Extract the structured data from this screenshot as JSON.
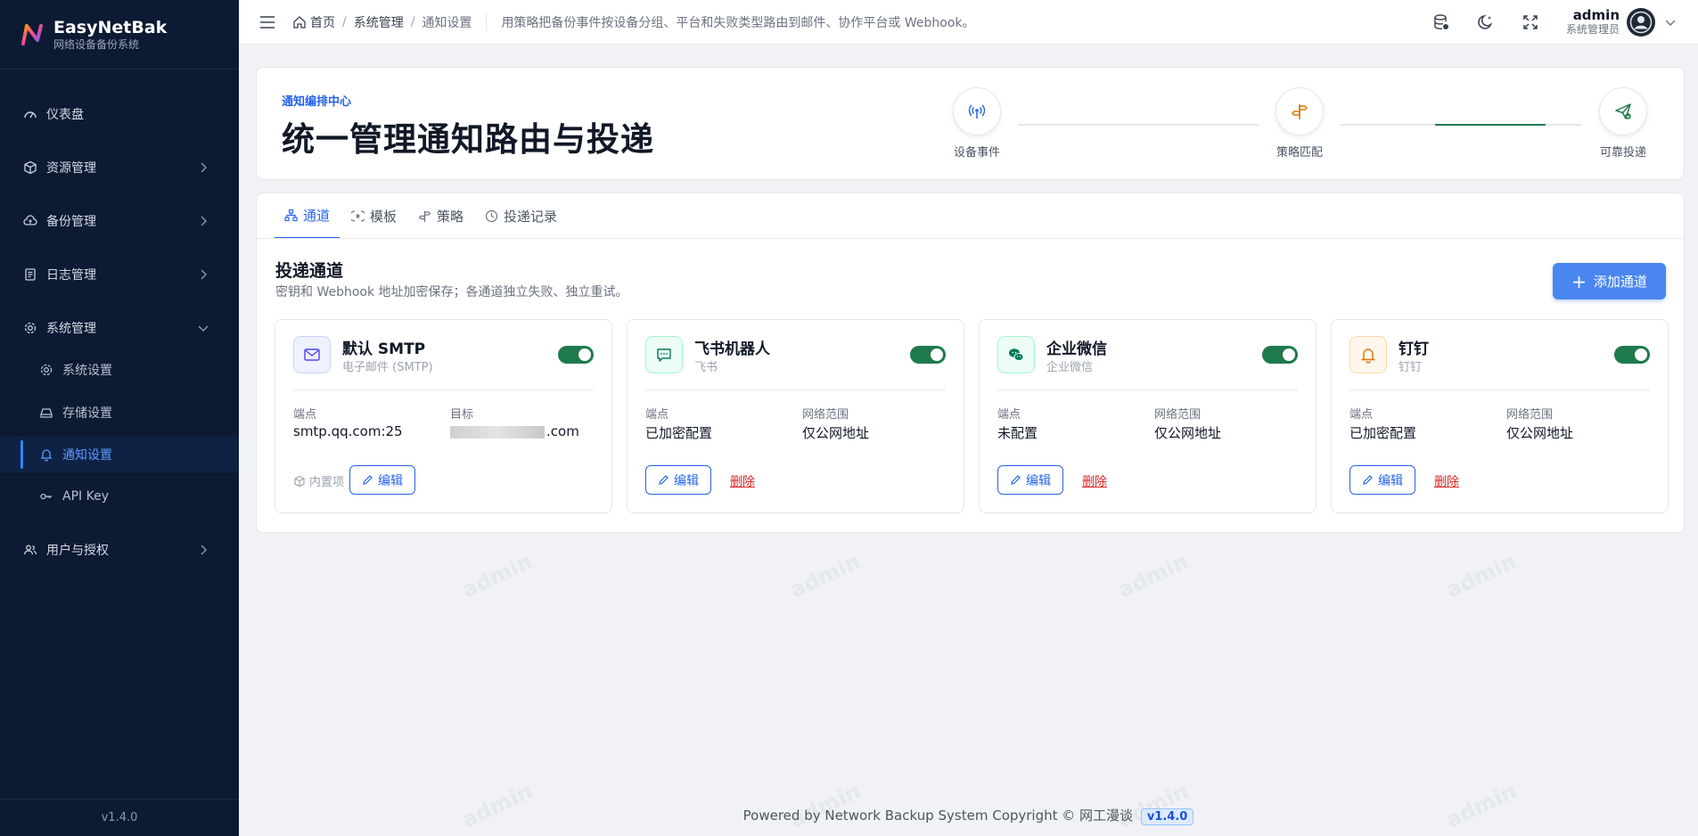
{
  "brand": {
    "name": "EasyNetBak",
    "subtitle": "网络设备备份系统"
  },
  "sidebar": {
    "items": [
      {
        "label": "仪表盘",
        "icon": "dashboard-icon"
      },
      {
        "label": "资源管理",
        "icon": "cube-icon"
      },
      {
        "label": "备份管理",
        "icon": "cloud-upload-icon"
      },
      {
        "label": "日志管理",
        "icon": "document-icon"
      },
      {
        "label": "系统管理",
        "icon": "gear-icon"
      },
      {
        "label": "用户与授权",
        "icon": "users-icon"
      }
    ],
    "sub_items": [
      {
        "label": "系统设置",
        "icon": "gear-icon"
      },
      {
        "label": "存储设置",
        "icon": "drive-icon"
      },
      {
        "label": "通知设置",
        "icon": "bell-icon"
      },
      {
        "label": "API Key",
        "icon": "key-icon"
      }
    ],
    "version": "v1.4.0"
  },
  "topbar": {
    "breadcrumb": [
      "首页",
      "系统管理",
      "通知设置"
    ],
    "description": "用策略把备份事件按设备分组、平台和失败类型路由到邮件、协作平台或 Webhook。",
    "user": {
      "name": "admin",
      "role": "系统管理员"
    }
  },
  "hero": {
    "kicker": "通知编排中心",
    "title": "统一管理通知路由与投递",
    "steps": [
      {
        "label": "设备事件",
        "icon": "antenna-icon"
      },
      {
        "label": "策略匹配",
        "icon": "signpost-icon"
      },
      {
        "label": "可靠投递",
        "icon": "send-icon"
      }
    ]
  },
  "tabs": [
    {
      "label": "通道",
      "icon": "network-icon",
      "active": true
    },
    {
      "label": "模板",
      "icon": "template-icon",
      "active": false
    },
    {
      "label": "策略",
      "icon": "signpost-icon",
      "active": false
    },
    {
      "label": "投递记录",
      "icon": "clock-icon",
      "active": false
    }
  ],
  "section": {
    "title": "投递通道",
    "subtitle": "密钥和 Webhook 地址加密保存；各通道独立失败、独立重试。",
    "add_label": "添加通道"
  },
  "channels": [
    {
      "name": "默认 SMTP",
      "type": "电子邮件 (SMTP)",
      "icon": "mail-icon",
      "enabled": true,
      "k1": "端点",
      "v1": "smtp.qq.com:25",
      "k2": "目标",
      "v2": ".com",
      "builtin": "内置项",
      "edit": "编辑"
    },
    {
      "name": "飞书机器人",
      "type": "飞书",
      "icon": "chat-icon",
      "enabled": true,
      "k1": "端点",
      "v1": "已加密配置",
      "k2": "网络范围",
      "v2": "仅公网地址",
      "edit": "编辑",
      "delete": "删除"
    },
    {
      "name": "企业微信",
      "type": "企业微信",
      "icon": "wechat-icon",
      "enabled": true,
      "k1": "端点",
      "v1": "未配置",
      "k2": "网络范围",
      "v2": "仅公网地址",
      "edit": "编辑",
      "delete": "删除"
    },
    {
      "name": "钉钉",
      "type": "钉钉",
      "icon": "bell-icon",
      "enabled": true,
      "k1": "端点",
      "v1": "已加密配置",
      "k2": "网络范围",
      "v2": "仅公网地址",
      "edit": "编辑",
      "delete": "删除"
    }
  ],
  "footer": {
    "text": "Powered by Network Backup System Copyright © 网工漫谈",
    "version": "v1.4.0"
  },
  "watermark": "admin"
}
